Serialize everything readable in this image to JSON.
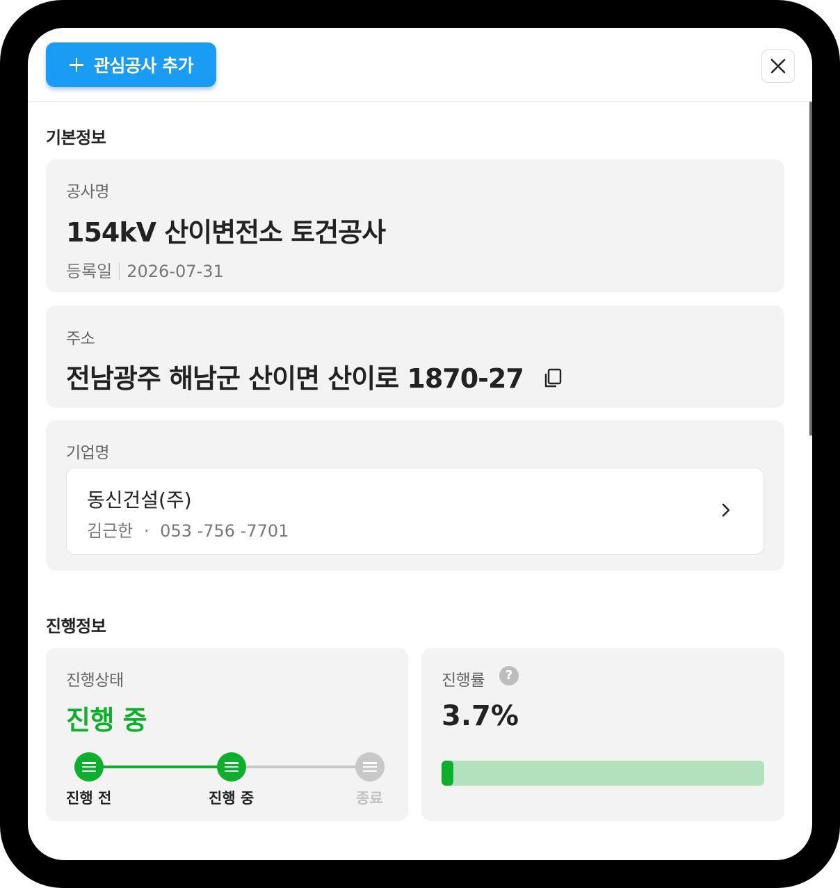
{
  "header": {
    "add_button_label": "관심공사 추가"
  },
  "basic_info": {
    "section_title": "기본정보",
    "project_name_label": "공사명",
    "project_name": "154kV 산이변전소 토건공사",
    "registered_label": "등록일",
    "registered_date": "2026-07-31",
    "address_label": "주소",
    "address": "전남광주 해남군 산이면 산이로 1870-27",
    "company_label": "기업명",
    "company_name": "동신건설(주)",
    "contact_person": "김근한",
    "contact_separator": "·",
    "contact_phone": "053 -756 -7701"
  },
  "progress_info": {
    "section_title": "진행정보",
    "status_label": "진행상태",
    "status_value": "진행 중",
    "steps": [
      {
        "label": "진행 전",
        "state": "done"
      },
      {
        "label": "진행 중",
        "state": "current"
      },
      {
        "label": "종료",
        "state": "pending"
      }
    ],
    "rate_label": "진행률",
    "rate_value": "3.7%",
    "rate_fraction": 0.037,
    "help_glyph": "?"
  },
  "colors": {
    "accent_blue": "#1a9cf5",
    "progress_green": "#0db02b",
    "progress_track": "#b4e1bd",
    "pending_gray": "#c8c8c8"
  },
  "icons": [
    "plus-icon",
    "close-icon",
    "copy-icon",
    "chevron-right-icon",
    "help-icon",
    "step-icon"
  ]
}
